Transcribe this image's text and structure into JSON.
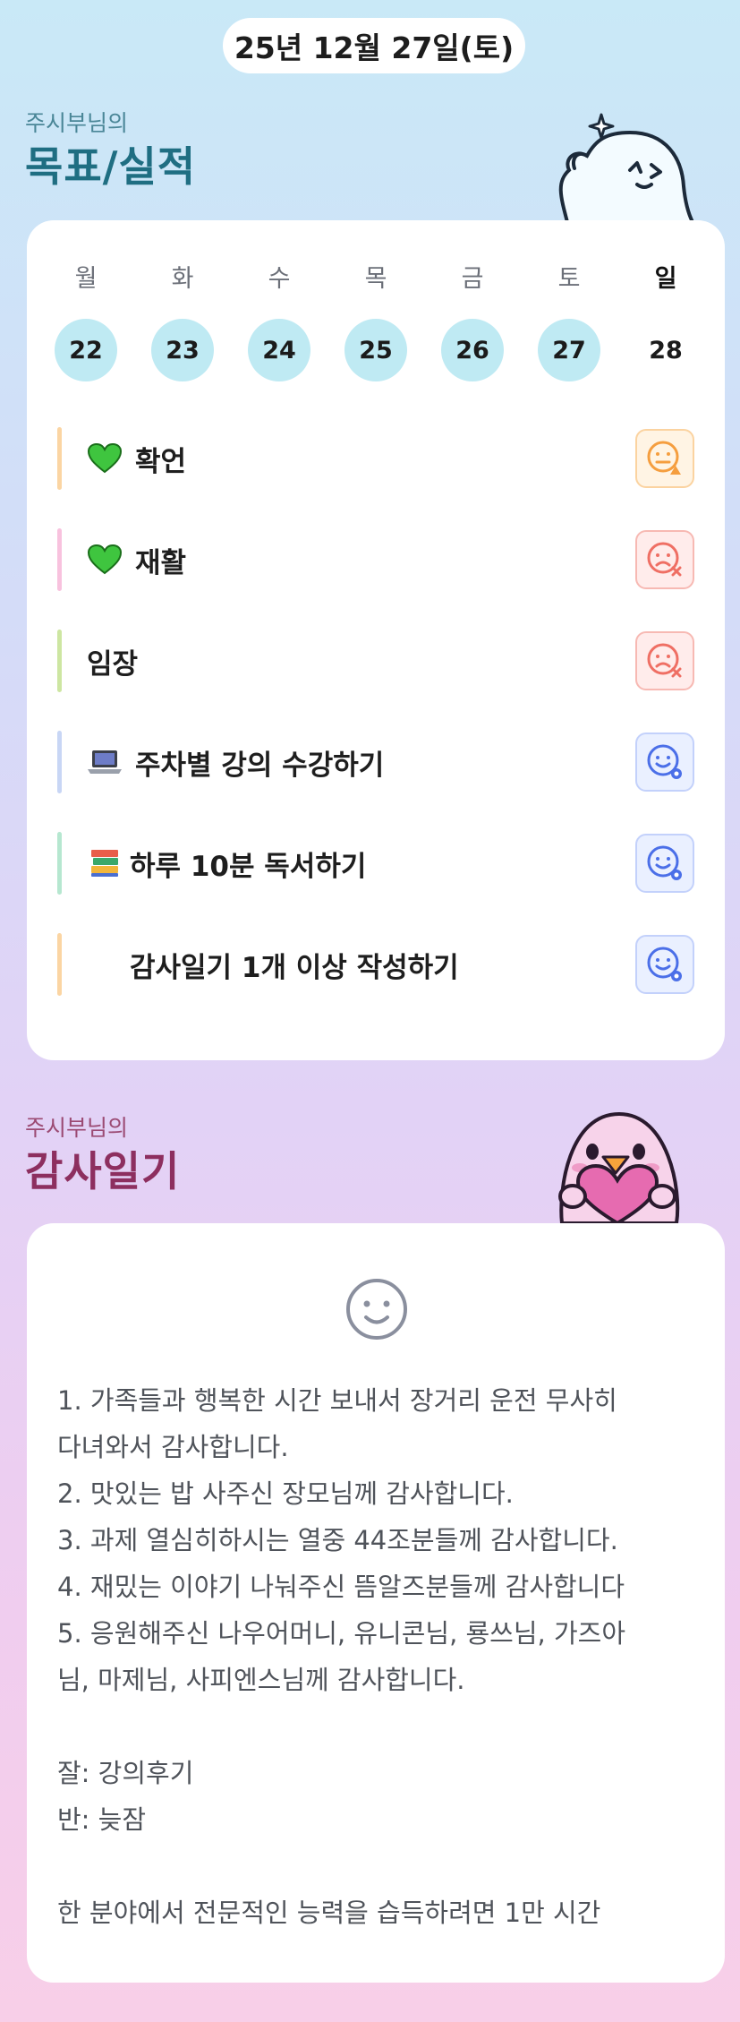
{
  "header": {
    "date": "25년 12월 27일(토)"
  },
  "goals_section": {
    "subtitle": "주시부님의",
    "title": "목표/실적"
  },
  "week": {
    "days": [
      {
        "dow": "월",
        "date": "22",
        "marked": true
      },
      {
        "dow": "화",
        "date": "23",
        "marked": true
      },
      {
        "dow": "수",
        "date": "24",
        "marked": true
      },
      {
        "dow": "목",
        "date": "25",
        "marked": true
      },
      {
        "dow": "금",
        "date": "26",
        "marked": true
      },
      {
        "dow": "토",
        "date": "27",
        "marked": true
      },
      {
        "dow": "일",
        "date": "28",
        "marked": false
      }
    ]
  },
  "goals": [
    {
      "label": "확언",
      "icon": "green-heart-icon",
      "bar_color": "#fbd5a3",
      "status": "warning-face-icon",
      "status_color": "#f59e3f"
    },
    {
      "label": "재활",
      "icon": "green-heart-icon",
      "bar_color": "#f8c2de",
      "status": "fail-face-icon",
      "status_color": "#ef6f64"
    },
    {
      "label": "임장",
      "icon": "",
      "bar_color": "#cde6a2",
      "status": "fail-face-icon",
      "status_color": "#ef6f64"
    },
    {
      "label": "주차별 강의 수강하기",
      "icon": "laptop-icon",
      "bar_color": "#c8d6f5",
      "status": "pending-face-icon",
      "status_color": "#4b6fe8"
    },
    {
      "label": "하루 10분 독서하기",
      "icon": "books-icon",
      "bar_color": "#b6e7d0",
      "status": "pending-face-icon",
      "status_color": "#4b6fe8"
    },
    {
      "label": "감사일기 1개 이상 작성하기",
      "icon": "",
      "bar_color": "#fbd5a3",
      "status": "pending-face-icon",
      "status_color": "#4b6fe8"
    }
  ],
  "diary_section": {
    "subtitle": "주시부님의",
    "title": "감사일기"
  },
  "diary": {
    "mood_icon": "smile-face-icon",
    "lines": [
      "1. 가족들과 행복한 시간 보내서 장거리 운전 무사히",
      "다녀와서 감사합니다.",
      "2. 맛있는 밥 사주신 장모님께 감사합니다.",
      "3. 과제 열심히하시는 열중 44조분들께 감사합니다.",
      "4. 재밌는 이야기 나눠주신 뜸알즈분들께 감사합니다",
      "5. 응원해주신 나우어머니, 유니콘님, 룡쓰님, 가즈아",
      "님, 마제님, 사피엔스님께 감사합니다.",
      "",
      "잘: 강의후기",
      "반: 늦잠",
      "",
      "한 분야에서 전문적인 능력을 습득하려면 1만 시간"
    ]
  },
  "colors": {
    "goals_title": "#1f6e82",
    "goals_subtitle": "#4a8697",
    "diary_title": "#8d2f5f",
    "diary_subtitle": "#9b4a73",
    "date_marked": "#bfeaf3"
  }
}
